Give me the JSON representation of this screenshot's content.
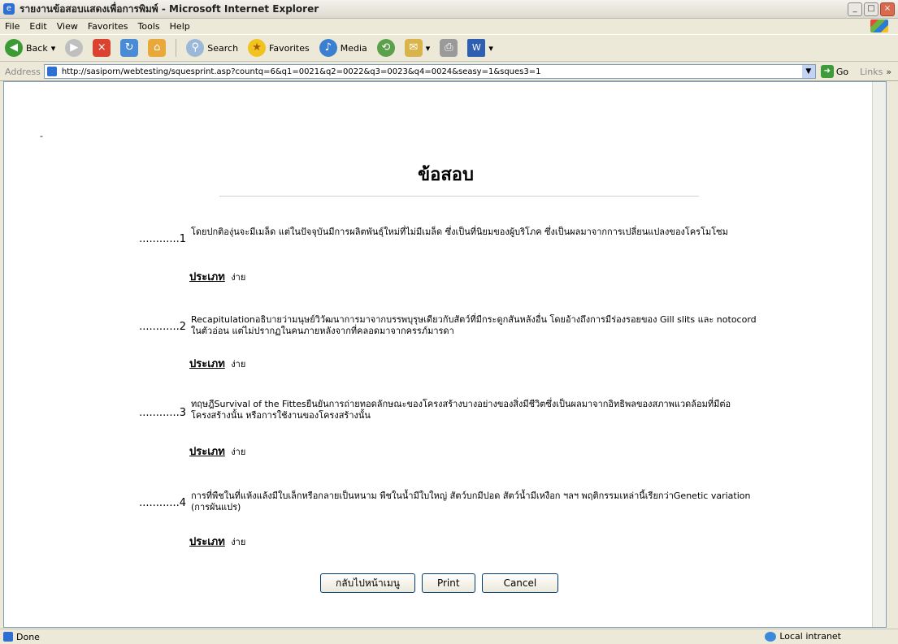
{
  "window": {
    "title": "รายงานข้อสอบแสดงเพื่อการพิมพ์ - Microsoft Internet Explorer"
  },
  "menu": [
    "File",
    "Edit",
    "View",
    "Favorites",
    "Tools",
    "Help"
  ],
  "toolbar": {
    "back": "Back",
    "search": "Search",
    "favorites": "Favorites",
    "media": "Media"
  },
  "address": {
    "label": "Address",
    "url": "http://sasiporn/webtesting/squesprint.asp?countq=6&q1=0021&q2=0022&q3=0023&q4=0024&seasy=1&sques3=1",
    "go": "Go",
    "links": "Links"
  },
  "page": {
    "marker": "-",
    "heading": "ข้อสอบ",
    "type_label": "ประเภท",
    "questions": [
      {
        "number": "............1",
        "text": "โดยปกติองุ่นจะมีเมล็ด แต่ในปัจจุบันมีการผลิตพันธุ์ใหม่ที่ไม่มีเมล็ด ซึ่งเป็นที่นิยมของผู้บริโภค ซึ่งเป็นผลมาจากการเปลี่ยนแปลงของโครโมโซม",
        "type": "ง่าย"
      },
      {
        "number": "............2",
        "text": "Recapitulationอธิบายว่ามนุษย์วิวัฒนาการมาจากบรรพบุรุษเดียวกับสัตว์ที่มีกระดูกสันหลังอื่น โดยอ้างถึงการมีร่องรอยของ Gill slits และ notocord ในตัวอ่อน แต่ไม่ปรากฏในคนภายหลังจากที่คลอดมาจากครรภ์มารดา",
        "type": "ง่าย"
      },
      {
        "number": "............3",
        "text": "ทฤษฎีSurvival of the Fittesยืนยันการถ่ายทอดลักษณะของโครงสร้างบางอย่างของสิ่งมีชีวิตซึ่งเป็นผลมาจากอิทธิพลของสภาพแวดล้อมที่มีต่อโครงสร้างนั้น หรือการใช้งานของโครงสร้างนั้น",
        "type": "ง่าย"
      },
      {
        "number": "............4",
        "text": "การที่พืชในที่แห้งแล้งมีใบเล็กหรือกลายเป็นหนาม พืชในน้ำมีใบใหญ่ สัตว์บกมีปอด สัตว์น้ำมีเหงือก ฯลฯ พฤติกรรมเหล่านี้เรียกว่าGenetic variation (การผันแปร)",
        "type": "ง่าย"
      }
    ],
    "buttons": {
      "menu": "กลับไปหน้าเมนู",
      "print": "Print",
      "cancel": "Cancel"
    }
  },
  "status": {
    "left": "Done",
    "zone": "Local intranet"
  }
}
